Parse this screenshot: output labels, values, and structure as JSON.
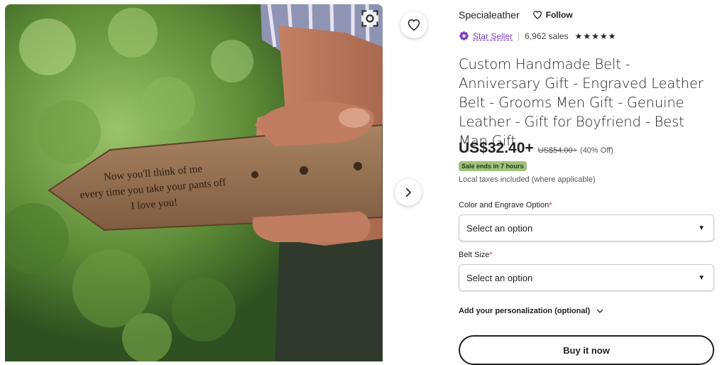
{
  "listing": {
    "title": "Custom Handmade Belt - Anniversary Gift - Engraved Leather Belt - Grooms Men Gift - Genuine Leather - Gift for Boyfriend - Best Man Gift",
    "engraving_lines": [
      "Now you'll think of me",
      "every time you take your pants off",
      "I love you!"
    ]
  },
  "shop": {
    "name": "Specialeather",
    "follow_label": "Follow",
    "star_seller_label": "Star Seller",
    "sales": "6,962 sales",
    "rating_stars": 5
  },
  "price": {
    "current": "US$32.40+",
    "original": "US$54.00+",
    "discount": "(40% Off)",
    "sale_badge": "Sale ends in 7 hours",
    "taxes_note": "Local taxes included (where applicable)"
  },
  "options": {
    "color_label": "Color and Engrave Option",
    "color_value": "Select an option",
    "size_label": "Belt Size",
    "size_value": "Select an option",
    "required_mark": "*"
  },
  "personalization": {
    "label": "Add your personalization (optional)"
  },
  "actions": {
    "buy_now": "Buy it now"
  },
  "icons": {
    "favorite": "heart-icon",
    "next": "chevron-right-icon",
    "lens": "visual-search-icon",
    "follow": "heart-outline-icon",
    "star_seller": "star-badge-icon",
    "rating": "star-icon",
    "expand": "chevron-down-icon"
  },
  "colors": {
    "star_seller": "#7e3ebf",
    "sale_badge_bg": "#9ec27d",
    "required": "#c0392b",
    "text": "#222222"
  }
}
